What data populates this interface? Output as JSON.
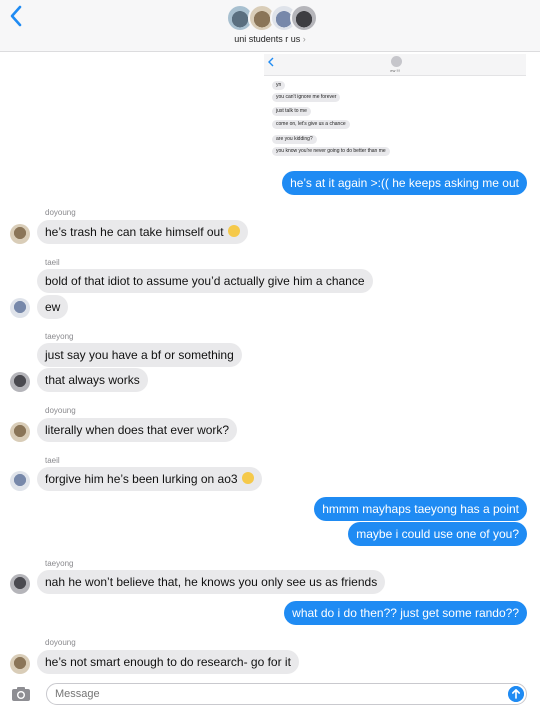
{
  "header": {
    "group_name": "uni students r us"
  },
  "embedded_screenshot": {
    "contact_name": "ew !!!",
    "messages": [
      "yn",
      "you can't ignore me forever",
      "just talk to me",
      "come on, let's give us a chance",
      "are you kidding?",
      "you know you're never going to do better than me"
    ]
  },
  "messages": [
    {
      "direction": "out",
      "text": "he’s at it again >:(( he keeps asking me out"
    },
    {
      "sender": "doyoung",
      "direction": "in",
      "text": "he’s trash he can take himself out",
      "icon": "crying-laughing-emoji-icon"
    },
    {
      "sender": "taeil",
      "direction": "in",
      "text": "bold of that idiot to assume you’d actually give him a chance"
    },
    {
      "direction": "in",
      "text": "ew"
    },
    {
      "sender": "taeyong",
      "direction": "in",
      "text": "just say you have a bf or something"
    },
    {
      "direction": "in",
      "text": "that always works"
    },
    {
      "sender": "doyoung",
      "direction": "in",
      "text": "literally when does that ever work?"
    },
    {
      "sender": "taeil",
      "direction": "in",
      "text": "forgive him he’s been lurking on ao3",
      "icon": "grimace-emoji-icon"
    },
    {
      "direction": "out",
      "text": "hmmm mayhaps taeyong has a point"
    },
    {
      "direction": "out",
      "text": "maybe i could use one of you?"
    },
    {
      "sender": "taeyong",
      "direction": "in",
      "text": "nah he won’t believe that, he knows you only see us as friends"
    },
    {
      "direction": "out",
      "text": "what do i do then?? just get some rando??"
    },
    {
      "sender": "doyoung",
      "direction": "in",
      "text": "he’s not smart enough to do research- go for it"
    }
  ],
  "input": {
    "placeholder": "Message"
  },
  "colors": {
    "accent": "#1f8bf3",
    "incoming_bubble": "#e9e9eb",
    "header_bg": "#f7f7f8"
  }
}
